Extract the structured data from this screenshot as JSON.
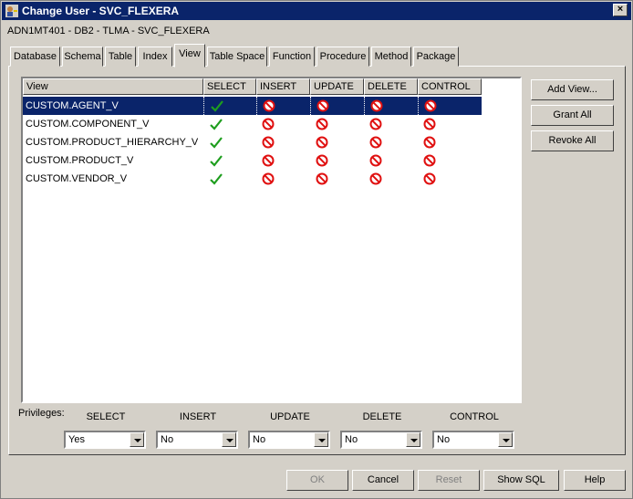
{
  "window": {
    "title": "Change User - SVC_FLEXERA",
    "subtitle": "ADN1MT401 - DB2 - TLMA - SVC_FLEXERA",
    "close_glyph": "×"
  },
  "tabs": [
    {
      "label": "Database"
    },
    {
      "label": "Schema"
    },
    {
      "label": "Table"
    },
    {
      "label": "Index"
    },
    {
      "label": "View",
      "active": true
    },
    {
      "label": "Table Space"
    },
    {
      "label": "Function"
    },
    {
      "label": "Procedure"
    },
    {
      "label": "Method"
    },
    {
      "label": "Package"
    }
  ],
  "grid": {
    "columns": [
      "View",
      "SELECT",
      "INSERT",
      "UPDATE",
      "DELETE",
      "CONTROL"
    ],
    "rows": [
      {
        "name": "CUSTOM.AGENT_V",
        "selected": true,
        "perms": [
          "granted",
          "denied",
          "denied",
          "denied",
          "denied"
        ]
      },
      {
        "name": "CUSTOM.COMPONENT_V",
        "perms": [
          "granted",
          "denied",
          "denied",
          "denied",
          "denied"
        ]
      },
      {
        "name": "CUSTOM.PRODUCT_HIERARCHY_V",
        "perms": [
          "granted",
          "denied",
          "denied",
          "denied",
          "denied"
        ]
      },
      {
        "name": "CUSTOM.PRODUCT_V",
        "perms": [
          "granted",
          "denied",
          "denied",
          "denied",
          "denied"
        ]
      },
      {
        "name": "CUSTOM.VENDOR_V",
        "perms": [
          "granted",
          "denied",
          "denied",
          "denied",
          "denied"
        ]
      }
    ]
  },
  "side_buttons": {
    "add_view": "Add View...",
    "grant_all": "Grant All",
    "revoke_all": "Revoke All"
  },
  "privileges": {
    "label": "Privileges:",
    "columns": [
      {
        "label": "SELECT",
        "value": "Yes"
      },
      {
        "label": "INSERT",
        "value": "No"
      },
      {
        "label": "UPDATE",
        "value": "No"
      },
      {
        "label": "DELETE",
        "value": "No"
      },
      {
        "label": "CONTROL",
        "value": "No"
      }
    ]
  },
  "footer": {
    "ok": "OK",
    "cancel": "Cancel",
    "reset": "Reset",
    "show_sql": "Show SQL",
    "help": "Help"
  },
  "colors": {
    "granted": "#1e9e1e",
    "denied": "#e01010",
    "selection": "#0a246a"
  },
  "icons": {
    "granted": "checkmark-icon",
    "denied": "no-entry-icon"
  }
}
